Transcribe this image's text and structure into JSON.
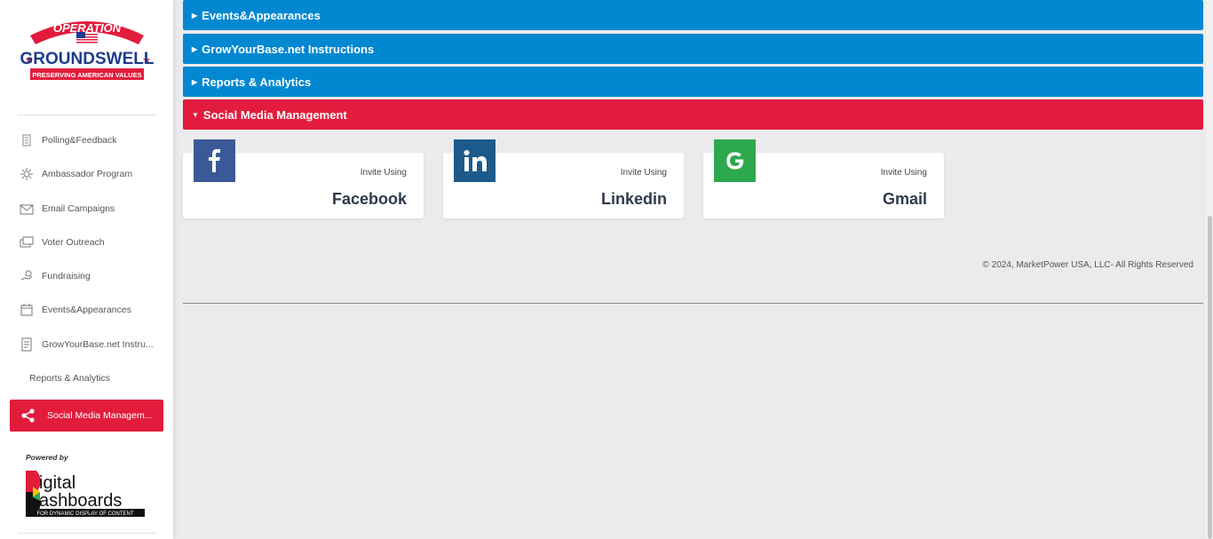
{
  "logo": {
    "top_text": "OPERATION",
    "main_text": "GROUNDSWELL",
    "tagline": "PRESERVING AMERICAN VALUES"
  },
  "sidebar": {
    "items": [
      {
        "label": "Polling&Feedback",
        "icon": "poll-icon"
      },
      {
        "label": "Ambassador Program",
        "icon": "ambassador-icon"
      },
      {
        "label": "Email Campaigns",
        "icon": "email-icon"
      },
      {
        "label": "Voter Outreach",
        "icon": "outreach-icon"
      },
      {
        "label": "Fundraising",
        "icon": "fundraising-icon"
      },
      {
        "label": "Events&Appearances",
        "icon": "calendar-icon"
      },
      {
        "label": "GrowYourBase.net Instru...",
        "icon": "document-icon"
      },
      {
        "label": "Reports & Analytics",
        "icon": ""
      },
      {
        "label": "Social Media Managem...",
        "icon": "share-icon",
        "active": true
      }
    ],
    "powered_by": "Powered by",
    "powered_logo": {
      "line1": "igital",
      "line2": "ashboards",
      "tagline": "FOR DYNAMIC DISPLAY OF CONTENT"
    }
  },
  "main": {
    "sections": [
      {
        "label": "Events&Appearances",
        "state": "collapsed"
      },
      {
        "label": "GrowYourBase.net Instructions",
        "state": "collapsed"
      },
      {
        "label": "Reports & Analytics",
        "state": "collapsed"
      },
      {
        "label": "Social Media Management",
        "state": "expanded"
      }
    ],
    "cards": [
      {
        "invite": "Invite Using",
        "name": "Facebook",
        "badge_color": "#3b5998"
      },
      {
        "invite": "Invite Using",
        "name": "Linkedin",
        "badge_color": "#1d5a8c"
      },
      {
        "invite": "Invite Using",
        "name": "Gmail",
        "badge_color": "#2ea84f"
      }
    ],
    "footer": "© 2024, MarketPower USA, LLC- All Rights Reserved"
  },
  "colors": {
    "accordion_blue": "#0288d1",
    "accent_red": "#e31c3d",
    "background": "#ebebed"
  }
}
